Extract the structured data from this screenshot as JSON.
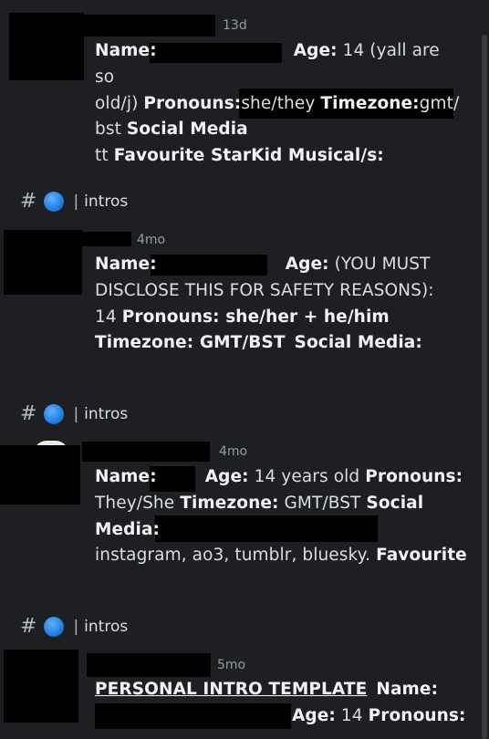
{
  "messages": [
    {
      "timestamp": "13d",
      "lines": {
        "l1_name": "Name:",
        "l1_age": "Age:",
        "l1_age_val": " 14 (yall are so",
        "l2_a": "old/j) ",
        "l2_pron": "Pronouns:",
        "l2_pron_val": "she/they ",
        "l2_tz": "Timezone:",
        "l2_tz_val": "gmt/",
        "l3_a": "bst ",
        "l3_sm": "Social Media",
        "l4_a": "tt ",
        "l4_fav": "Favourite StarKid Musical/s:"
      }
    },
    {
      "timestamp": "4mo",
      "lines": {
        "l1_name": "Name:",
        "l1_age": "Age:",
        "l1_age_val": " (YOU MUST",
        "l2": "DISCLOSE THIS FOR SAFETY REASONS):",
        "l3_a": "14 ",
        "l3_pron": "Pronouns: she/her + he/him",
        "l4_tz": "Timezone: GMT/BST",
        "l4_sm": "Social Media:"
      }
    },
    {
      "timestamp": "4mo",
      "lines": {
        "l1_name": "Name:",
        "l1_age": "Age:",
        "l1_age_val": " 14 years old ",
        "l1_pron": "Pronouns:",
        "l2_a": "They/She ",
        "l2_tz": "Timezone:",
        "l2_tz_val": " GMT/BST ",
        "l2_sm": "Social",
        "l3_sm": "Media:",
        "l4_a": "instagram, ao3, tumblr, bluesky. ",
        "l4_fav": "Favourite"
      }
    },
    {
      "timestamp": "5mo",
      "lines": {
        "l1_tpl": "PERSONAL INTRO TEMPLATE",
        "l1_name": "Name:",
        "l2_age": "Age:",
        "l2_age_val": " 14 ",
        "l2_pron": "Pronouns:"
      }
    }
  ],
  "channel": {
    "hash": "#",
    "separator": "|",
    "name": "intros"
  }
}
